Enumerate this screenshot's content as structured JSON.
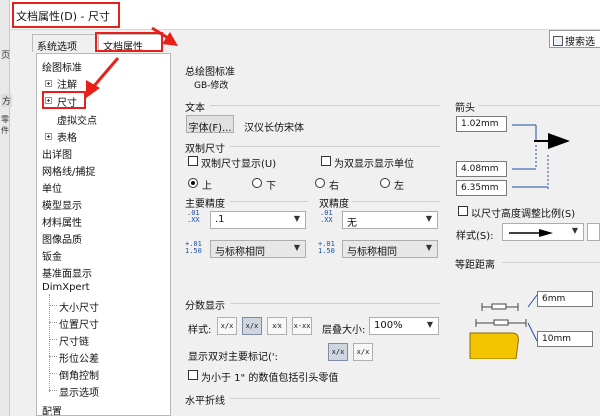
{
  "window": {
    "title": "文档属性(D) - 尺寸"
  },
  "left_strip": [
    "页",
    "方",
    "零件"
  ],
  "tabs": [
    {
      "label": "系统选项(S)"
    },
    {
      "label": "文档属性(D)"
    }
  ],
  "search": {
    "label": "搜索选"
  },
  "tree": {
    "items": [
      {
        "label": "绘图标准"
      },
      {
        "label": "注解"
      },
      {
        "label": "尺寸"
      },
      {
        "label": "虚拟交点"
      },
      {
        "label": "表格"
      },
      {
        "label": "出详图"
      },
      {
        "label": "网格线/捕捉"
      },
      {
        "label": "单位"
      },
      {
        "label": "模型显示"
      },
      {
        "label": "材料属性"
      },
      {
        "label": "图像品质"
      },
      {
        "label": "钣金"
      },
      {
        "label": "基准面显示"
      },
      {
        "label": "DimXpert"
      },
      {
        "label": "大小尺寸"
      },
      {
        "label": "位置尺寸"
      },
      {
        "label": "尺寸链"
      },
      {
        "label": "形位公差"
      },
      {
        "label": "倒角控制"
      },
      {
        "label": "显示选项"
      },
      {
        "label": "配置"
      }
    ]
  },
  "panel": {
    "overall_standard": {
      "heading": "总绘图标准",
      "value": "GB-修改"
    },
    "text": {
      "heading": "文本",
      "font_button": "字体(F)...",
      "font_name": "汉仪长仿宋体"
    },
    "dual": {
      "heading": "双制尺寸",
      "show_dual": "双制尺寸显示(U)",
      "show_units": "为双显示显示单位",
      "positions": [
        "上",
        "下",
        "右",
        "左"
      ],
      "selected": "上"
    },
    "primary_precision": {
      "heading": "主要精度",
      "sym_top": ".01",
      "sym_top2": ".XX",
      "sym_bot": "1.50",
      "sym_bot2": "+.01",
      "value1": ".1",
      "value2": "与标称相同"
    },
    "dual_precision": {
      "heading": "双精度",
      "value1": "无",
      "value2": "与标称相同"
    },
    "fraction": {
      "heading": "分数显示",
      "style_label": "样式:",
      "stack_label": "层叠大小:",
      "stack_value": "100%",
      "show_dual_label": "显示双对主要标记(':",
      "leading_zero": "为小于 1\" 的数值包括引头零值"
    },
    "horizontal": {
      "heading": "水平折线"
    },
    "arrows": {
      "heading": "箭头",
      "v1": "1.02mm",
      "v2": "4.08mm",
      "v3": "6.35mm",
      "scale_label": "以尺寸高度调整比例(S)",
      "style_label": "样式(S):"
    },
    "offset": {
      "heading": "等距距离",
      "v1": "6mm",
      "v2": "10mm"
    }
  },
  "icons": {
    "accent": "#e8201a",
    "tree_arrow_color": "#e8201a"
  }
}
